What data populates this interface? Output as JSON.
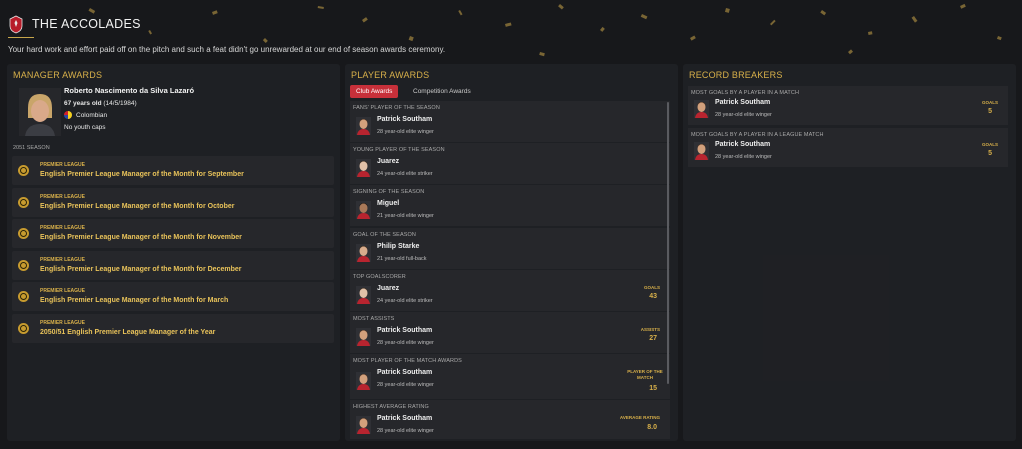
{
  "header": {
    "title": "THE ACCOLADES",
    "subtitle": "Your hard work and effort paid off on the pitch and such a feat didn't go unrewarded at our end of season awards ceremony."
  },
  "colors": {
    "accent_gold": "#d8b04a",
    "tab_active": "#c7303a",
    "panel_bg": "#1f2024",
    "card_bg": "#26272b"
  },
  "manager": {
    "section_title": "MANAGER AWARDS",
    "name": "Roberto Nascimento da Silva Lazaró",
    "age": "67 years old",
    "dob": "(14/5/1984)",
    "nationality": "Colombian",
    "caps": "No youth caps",
    "season": "2051 SEASON",
    "awards": [
      {
        "league": "PREMIER LEAGUE",
        "name": "English Premier League Manager of the Month for September"
      },
      {
        "league": "PREMIER LEAGUE",
        "name": "English Premier League Manager of the Month for October"
      },
      {
        "league": "PREMIER LEAGUE",
        "name": "English Premier League Manager of the Month for November"
      },
      {
        "league": "PREMIER LEAGUE",
        "name": "English Premier League Manager of the Month for December"
      },
      {
        "league": "PREMIER LEAGUE",
        "name": "English Premier League Manager of the Month for March"
      },
      {
        "league": "PREMIER LEAGUE",
        "name": "2050/51 English Premier League Manager of the Year"
      }
    ]
  },
  "players": {
    "section_title": "PLAYER AWARDS",
    "tabs": [
      "Club Awards",
      "Competition Awards"
    ],
    "awards": [
      {
        "category": "FANS' PLAYER OF THE SEASON",
        "player": "Patrick Southam",
        "desc": "28 year-old elite winger"
      },
      {
        "category": "YOUNG PLAYER OF THE SEASON",
        "player": "Juarez",
        "desc": "24 year-old elite striker"
      },
      {
        "category": "SIGNING OF THE SEASON",
        "player": "Miguel",
        "desc": "21 year-old elite winger"
      },
      {
        "category": "GOAL OF THE SEASON",
        "player": "Philip Starke",
        "desc": "21 year-old full-back"
      },
      {
        "category": "TOP GOALSCORER",
        "player": "Juarez",
        "desc": "24 year-old elite striker",
        "stat_label": "GOALS",
        "stat_value": "43"
      },
      {
        "category": "MOST ASSISTS",
        "player": "Patrick Southam",
        "desc": "28 year-old elite winger",
        "stat_label": "ASSISTS",
        "stat_value": "27"
      },
      {
        "category": "MOST PLAYER OF THE MATCH AWARDS",
        "player": "Patrick Southam",
        "desc": "28 year-old elite winger",
        "stat_label": "PLAYER OF THE MATCH",
        "stat_value": "15"
      },
      {
        "category": "HIGHEST AVERAGE RATING",
        "player": "Patrick Southam",
        "desc": "28 year-old elite winger",
        "stat_label": "AVERAGE RATING",
        "stat_value": "8.0"
      }
    ]
  },
  "records": {
    "section_title": "RECORD BREAKERS",
    "items": [
      {
        "category": "MOST GOALS BY A PLAYER IN A MATCH",
        "player": "Patrick Southam",
        "desc": "28 year-old elite winger",
        "stat_label": "GOALS",
        "stat_value": "5"
      },
      {
        "category": "MOST GOALS BY A PLAYER IN A LEAGUE MATCH",
        "player": "Patrick Southam",
        "desc": "28 year-old elite winger",
        "stat_label": "GOALS",
        "stat_value": "5"
      }
    ]
  }
}
